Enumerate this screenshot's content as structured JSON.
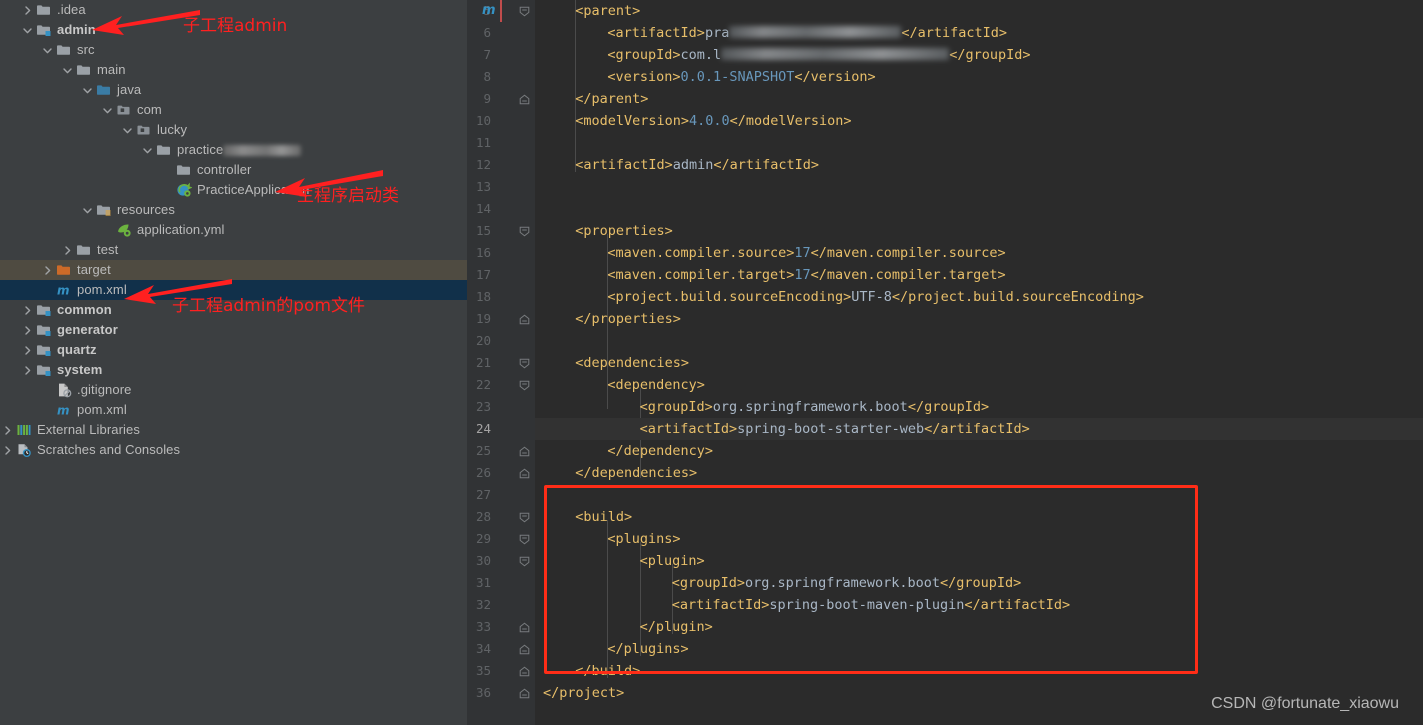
{
  "sidebar": {
    "items": [
      {
        "label": ".idea",
        "icon": "folder-icon",
        "indent": 1,
        "twisty": "collapsed",
        "bold": false,
        "state": "normal"
      },
      {
        "label": "admin",
        "icon": "module-folder-icon",
        "indent": 1,
        "twisty": "expanded",
        "bold": true,
        "state": "normal"
      },
      {
        "label": "src",
        "icon": "folder-icon",
        "indent": 2,
        "twisty": "expanded",
        "bold": false,
        "state": "normal"
      },
      {
        "label": "main",
        "icon": "folder-icon",
        "indent": 3,
        "twisty": "expanded",
        "bold": false,
        "state": "normal"
      },
      {
        "label": "java",
        "icon": "source-folder-icon",
        "indent": 4,
        "twisty": "expanded",
        "bold": false,
        "state": "normal"
      },
      {
        "label": "com",
        "icon": "package-icon",
        "indent": 5,
        "twisty": "expanded",
        "bold": false,
        "state": "normal"
      },
      {
        "label": "lucky",
        "icon": "package-icon",
        "indent": 6,
        "twisty": "expanded",
        "bold": false,
        "state": "normal"
      },
      {
        "label": "practice",
        "icon": "folder-icon",
        "indent": 7,
        "twisty": "expanded",
        "bold": false,
        "state": "redacted"
      },
      {
        "label": "controller",
        "icon": "folder-icon",
        "indent": 8,
        "twisty": "none",
        "bold": false,
        "state": "normal"
      },
      {
        "label": "PracticeApplication",
        "icon": "spring-class-icon",
        "indent": 8,
        "twisty": "none",
        "bold": false,
        "state": "normal"
      },
      {
        "label": "resources",
        "icon": "resources-folder-icon",
        "indent": 4,
        "twisty": "expanded",
        "bold": false,
        "state": "normal"
      },
      {
        "label": "application.yml",
        "icon": "spring-yaml-icon",
        "indent": 5,
        "twisty": "none",
        "bold": false,
        "state": "normal"
      },
      {
        "label": "test",
        "icon": "folder-icon",
        "indent": 3,
        "twisty": "collapsed",
        "bold": false,
        "state": "normal"
      },
      {
        "label": "target",
        "icon": "target-folder-icon",
        "indent": 2,
        "twisty": "collapsed",
        "bold": false,
        "state": "highlighted"
      },
      {
        "label": "pom.xml",
        "icon": "maven-icon",
        "indent": 2,
        "twisty": "none",
        "bold": false,
        "state": "selected"
      },
      {
        "label": "common",
        "icon": "module-folder-icon",
        "indent": 1,
        "twisty": "collapsed",
        "bold": true,
        "state": "normal"
      },
      {
        "label": "generator",
        "icon": "module-folder-icon",
        "indent": 1,
        "twisty": "collapsed",
        "bold": true,
        "state": "normal"
      },
      {
        "label": "quartz",
        "icon": "module-folder-icon",
        "indent": 1,
        "twisty": "collapsed",
        "bold": true,
        "state": "normal"
      },
      {
        "label": "system",
        "icon": "module-folder-icon",
        "indent": 1,
        "twisty": "collapsed",
        "bold": true,
        "state": "normal"
      },
      {
        "label": ".gitignore",
        "icon": "gitignore-icon",
        "indent": 2,
        "twisty": "none",
        "bold": false,
        "state": "normal"
      },
      {
        "label": "pom.xml",
        "icon": "maven-icon",
        "indent": 2,
        "twisty": "none",
        "bold": false,
        "state": "normal"
      },
      {
        "label": "External Libraries",
        "icon": "libraries-icon",
        "indent": 0,
        "twisty": "collapsed",
        "bold": false,
        "state": "normal"
      },
      {
        "label": "Scratches and Consoles",
        "icon": "scratches-icon",
        "indent": 0,
        "twisty": "collapsed",
        "bold": false,
        "state": "normal"
      }
    ]
  },
  "editor": {
    "file_marker": "m",
    "current_line": 24,
    "first_line": 5,
    "lines": [
      {
        "n": 5,
        "indent": 1,
        "text": "<parent>",
        "fold": "start"
      },
      {
        "n": 6,
        "indent": 2,
        "text": "<artifactId>pra",
        "suffix": "</artifactId>",
        "redacted": true
      },
      {
        "n": 7,
        "indent": 2,
        "text": "<groupId>com.l",
        "suffix": "</groupId>",
        "redacted": true
      },
      {
        "n": 8,
        "indent": 2,
        "text": "<version>0.0.1-SNAPSHOT</version>"
      },
      {
        "n": 9,
        "indent": 1,
        "text": "</parent>",
        "fold": "end"
      },
      {
        "n": 10,
        "indent": 1,
        "text": "<modelVersion>4.0.0</modelVersion>"
      },
      {
        "n": 11,
        "indent": 0,
        "text": ""
      },
      {
        "n": 12,
        "indent": 1,
        "text": "<artifactId>admin</artifactId>"
      },
      {
        "n": 13,
        "indent": 0,
        "text": ""
      },
      {
        "n": 14,
        "indent": 0,
        "text": ""
      },
      {
        "n": 15,
        "indent": 1,
        "text": "<properties>",
        "fold": "start"
      },
      {
        "n": 16,
        "indent": 2,
        "text": "<maven.compiler.source>17</maven.compiler.source>"
      },
      {
        "n": 17,
        "indent": 2,
        "text": "<maven.compiler.target>17</maven.compiler.target>"
      },
      {
        "n": 18,
        "indent": 2,
        "text": "<project.build.sourceEncoding>UTF-8</project.build.sourceEncoding>"
      },
      {
        "n": 19,
        "indent": 1,
        "text": "</properties>",
        "fold": "end"
      },
      {
        "n": 20,
        "indent": 0,
        "text": ""
      },
      {
        "n": 21,
        "indent": 1,
        "text": "<dependencies>",
        "fold": "start"
      },
      {
        "n": 22,
        "indent": 2,
        "text": "<dependency>",
        "fold": "start"
      },
      {
        "n": 23,
        "indent": 3,
        "text": "<groupId>org.springframework.boot</groupId>"
      },
      {
        "n": 24,
        "indent": 3,
        "text": "<artifactId>spring-boot-starter-web</artifactId>"
      },
      {
        "n": 25,
        "indent": 2,
        "text": "</dependency>",
        "fold": "end"
      },
      {
        "n": 26,
        "indent": 1,
        "text": "</dependencies>",
        "fold": "end"
      },
      {
        "n": 27,
        "indent": 0,
        "text": ""
      },
      {
        "n": 28,
        "indent": 1,
        "text": "<build>",
        "fold": "start"
      },
      {
        "n": 29,
        "indent": 2,
        "text": "<plugins>",
        "fold": "start"
      },
      {
        "n": 30,
        "indent": 3,
        "text": "<plugin>",
        "fold": "start"
      },
      {
        "n": 31,
        "indent": 4,
        "text": "<groupId>org.springframework.boot</groupId>"
      },
      {
        "n": 32,
        "indent": 4,
        "text": "<artifactId>spring-boot-maven-plugin</artifactId>"
      },
      {
        "n": 33,
        "indent": 3,
        "text": "</plugin>",
        "fold": "end"
      },
      {
        "n": 34,
        "indent": 2,
        "text": "</plugins>",
        "fold": "end"
      },
      {
        "n": 35,
        "indent": 1,
        "text": "</build>",
        "fold": "end"
      },
      {
        "n": 36,
        "indent": 0,
        "text": "</project>",
        "fold": "end"
      }
    ]
  },
  "annotations": [
    {
      "name": "annotation-submodule-admin",
      "text": "子工程admin"
    },
    {
      "name": "annotation-main-application-class",
      "text": "主程序启动类"
    },
    {
      "name": "annotation-admin-pom-file",
      "text": "子工程admin的pom文件"
    }
  ],
  "watermark": {
    "text": "CSDN @fortunate_xiaowu"
  },
  "colors": {
    "sidebar_bg": "#3c3f41",
    "editor_bg": "#2b2b2b",
    "gutter_bg": "#313335",
    "selection": "#11304a",
    "row_highlight": "#4f4b41",
    "annotation_red": "#ff2020",
    "tag": "#e8bf6a",
    "value": "#a9b7c6",
    "number": "#6897bb"
  }
}
